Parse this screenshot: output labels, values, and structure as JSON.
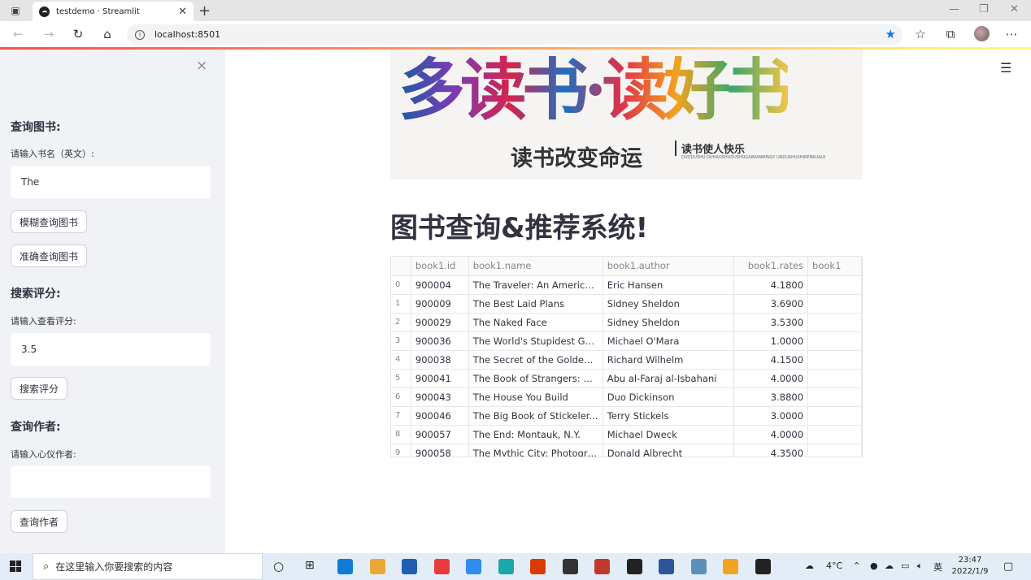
{
  "browser": {
    "tab_title": "testdemo · Streamlit",
    "url": "localhost:8501"
  },
  "sidebar": {
    "close_glyph": "×",
    "sections": [
      {
        "heading": "查询图书:",
        "label": "请输入书名（英文）:",
        "input_value": "The",
        "buttons": [
          "模糊查询图书",
          "准确查询图书"
        ]
      },
      {
        "heading": "搜索评分:",
        "label": "请输入查看评分:",
        "input_value": "3.5",
        "buttons": [
          "搜索评分"
        ]
      },
      {
        "heading": "查询作者:",
        "label": "请输入心仪作者:",
        "input_value": "",
        "buttons": [
          "查询作者"
        ]
      }
    ]
  },
  "banner": {
    "main_text": "多读书·读好书",
    "sub_text": "读书改变命运",
    "side_text": "读书使人快乐",
    "small_text": "DUODUSHU DUHAOSHUDUSHUGAIBIANMINGY UNDUSHUSHIRENKUALE"
  },
  "main": {
    "title": "图书查询&推荐系统!",
    "table": {
      "columns": [
        "",
        "book1.id",
        "book1.name",
        "book1.author",
        "book1.rates",
        "book1"
      ],
      "rows": [
        [
          "0",
          "900004",
          "The Traveler: An America...",
          "Eric Hansen",
          "4.1800",
          ""
        ],
        [
          "1",
          "900009",
          "The Best Laid Plans",
          "Sidney Sheldon",
          "3.6900",
          ""
        ],
        [
          "2",
          "900029",
          "The Naked Face",
          "Sidney Sheldon",
          "3.5300",
          ""
        ],
        [
          "3",
          "900036",
          "The World's Stupidest Gra...",
          "Michael O'Mara",
          "1.0000",
          ""
        ],
        [
          "4",
          "900038",
          "The Secret of the Golden ...",
          "Richard Wilhelm",
          "4.1500",
          ""
        ],
        [
          "5",
          "900041",
          "The Book of Strangers: M...",
          "Abu al-Faraj al-Isbahani",
          "4.0000",
          ""
        ],
        [
          "6",
          "900043",
          "The House You Build",
          "Duo Dickinson",
          "3.8800",
          ""
        ],
        [
          "7",
          "900046",
          "The Big Book of Stickeler...",
          "Terry Stickels",
          "3.0000",
          ""
        ],
        [
          "8",
          "900057",
          "The End: Montauk, N.Y.",
          "Michael Dweck",
          "4.0000",
          ""
        ],
        [
          "9",
          "900058",
          "The Mythic City: Photogra...",
          "Donald Albrecht",
          "4.3500",
          ""
        ]
      ]
    }
  },
  "taskbar": {
    "search_placeholder": "在这里输入你要搜索的内容",
    "weather": "4°C",
    "ime": "英",
    "time": "23:47",
    "date": "2022/1/9",
    "app_colors": [
      "#0f7bd6",
      "#e8a838",
      "#1e5fb3",
      "#e83c3c",
      "#2f8cf0",
      "#1aa8a8",
      "#d83b01",
      "#333333",
      "#c0392b",
      "#222222",
      "#2b579a",
      "#5b8fb9",
      "#f2a31f",
      "#222222"
    ]
  }
}
